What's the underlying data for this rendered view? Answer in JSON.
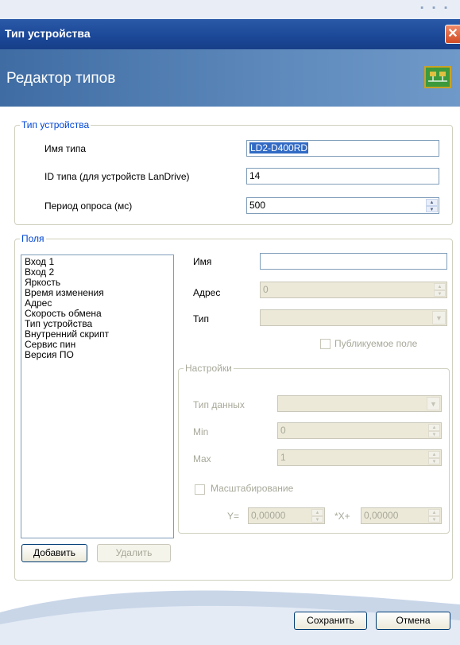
{
  "window": {
    "title": "Тип устройства",
    "close_glyph": "✕"
  },
  "banner": {
    "title": "Редактор типов"
  },
  "device_group": {
    "legend": "Тип устройства",
    "type_name_label": "Имя типа",
    "type_name_value": "LD2-D400RD",
    "type_id_label": "ID типа (для устройств LanDrive)",
    "type_id_value": "14",
    "poll_period_label": "Период опроса (мс)",
    "poll_period_value": "500"
  },
  "fields_group": {
    "legend": "Поля",
    "items": [
      "Вход 1",
      "Вход 2",
      "Яркость",
      "Время изменения",
      "Адрес",
      "Скорость обмена",
      "Тип устройства",
      "Внутренний скрипт",
      "Сервис пин",
      "Версия ПО"
    ],
    "name_label": "Имя",
    "name_value": "",
    "address_label": "Адрес",
    "address_value": "0",
    "type_label": "Тип",
    "type_value": "",
    "public_field_label": "Публикуемое поле",
    "settings": {
      "legend": "Настройки",
      "data_type_label": "Тип данных",
      "min_label": "Min",
      "min_value": "0",
      "max_label": "Max",
      "max_value": "1",
      "scaling_label": "Масштабирование",
      "y_label": "Y=",
      "y_value": "0,00000",
      "x_label": "*X+",
      "x_value": "0,00000"
    },
    "add_button": "Добавить",
    "delete_button": "Удалить"
  },
  "footer": {
    "save_button": "Сохранить",
    "cancel_button": "Отмена"
  },
  "colors": {
    "title_bar": "#1b4797",
    "banner": "#4a78b0",
    "legend_text": "#0046d5",
    "selection": "#316ac5"
  }
}
